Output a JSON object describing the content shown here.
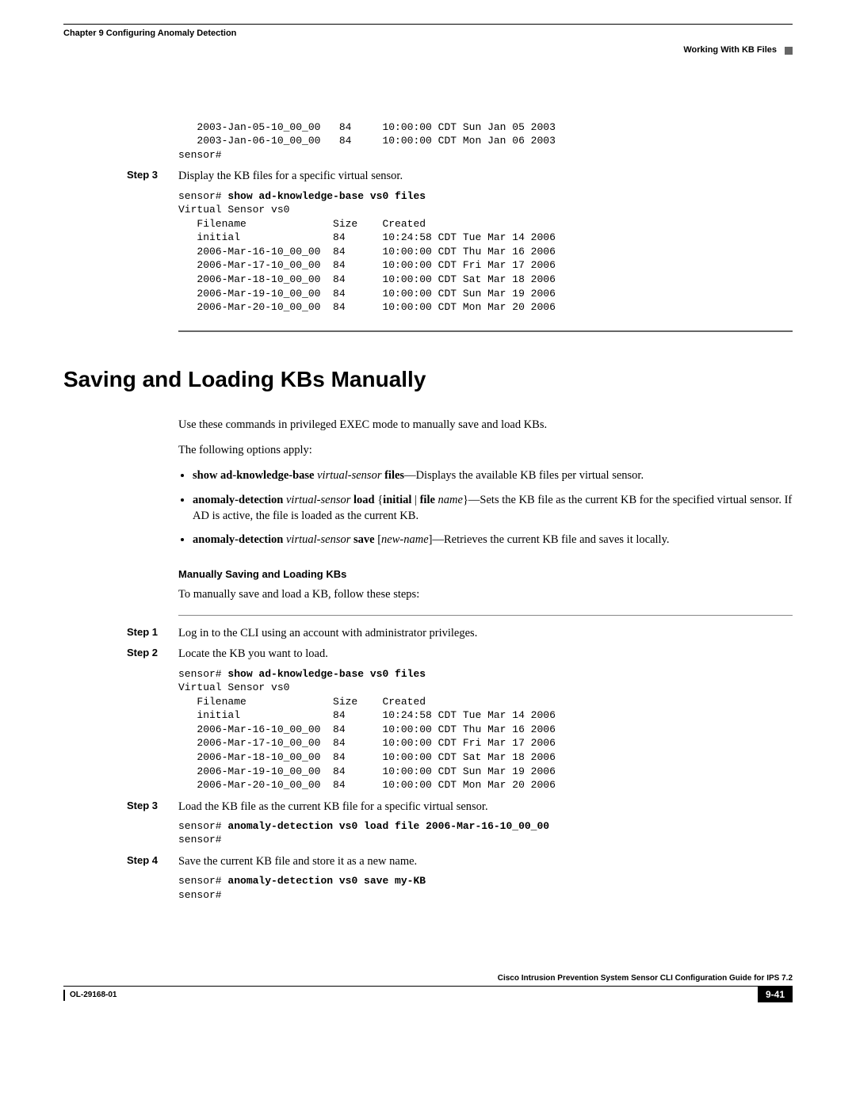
{
  "header": {
    "chapter": "Chapter 9      Configuring Anomaly Detection",
    "section": "Working With KB Files"
  },
  "codeblock1": "   2003-Jan-05-10_00_00   84     10:00:00 CDT Sun Jan 05 2003\n   2003-Jan-06-10_00_00   84     10:00:00 CDT Mon Jan 06 2003\nsensor#",
  "step3_top": {
    "label": "Step 3",
    "text": "Display the KB files for a specific virtual sensor."
  },
  "codeblock2_prompt": "sensor# ",
  "codeblock2_cmd": "show ad-knowledge-base vs0 files",
  "codeblock2_body": "Virtual Sensor vs0\n   Filename              Size    Created\n   initial               84      10:24:58 CDT Tue Mar 14 2006\n   2006-Mar-16-10_00_00  84      10:00:00 CDT Thu Mar 16 2006\n   2006-Mar-17-10_00_00  84      10:00:00 CDT Fri Mar 17 2006\n   2006-Mar-18-10_00_00  84      10:00:00 CDT Sat Mar 18 2006\n   2006-Mar-19-10_00_00  84      10:00:00 CDT Sun Mar 19 2006\n   2006-Mar-20-10_00_00  84      10:00:00 CDT Mon Mar 20 2006",
  "h1": "Saving and Loading KBs Manually",
  "intro1": "Use these commands in privileged EXEC mode to manually save and load KBs.",
  "intro2": "The following options apply:",
  "bullets": {
    "b1_bold1": "show ad-knowledge-base",
    "b1_italic1": " virtual-sensor ",
    "b1_bold2": "files",
    "b1_rest": "—Displays the available KB files per virtual sensor.",
    "b2_bold1": "anomaly-detection",
    "b2_italic1": " virtual-sensor ",
    "b2_bold2": "load",
    "b2_mid1": " {",
    "b2_bold3": "initial",
    "b2_mid2": " | ",
    "b2_bold4": "file",
    "b2_italic2": " name",
    "b2_mid3": "}—Sets the KB file as the current KB for the specified virtual sensor. If AD is active, the file is loaded as the current KB.",
    "b3_bold1": "anomaly-detection",
    "b3_italic1": " virtual-sensor ",
    "b3_bold2": "save",
    "b3_mid1": " [",
    "b3_italic2": "new-name",
    "b3_mid2": "]—Retrieves the current KB file and saves it locally."
  },
  "subheading": "Manually Saving and Loading KBs",
  "subintro": "To manually save and load a KB, follow these steps:",
  "steps": {
    "s1_label": "Step 1",
    "s1_text": "Log in to the CLI using an account with administrator privileges.",
    "s2_label": "Step 2",
    "s2_text": "Locate the KB you want to load.",
    "s3_label": "Step 3",
    "s3_text": "Load the KB file as the current KB file for a specific virtual sensor.",
    "s4_label": "Step 4",
    "s4_text": "Save the current KB file and store it as a new name."
  },
  "codeblock3_prompt": "sensor# ",
  "codeblock3_cmd": "show ad-knowledge-base vs0 files",
  "codeblock3_body": "Virtual Sensor vs0\n   Filename              Size    Created\n   initial               84      10:24:58 CDT Tue Mar 14 2006\n   2006-Mar-16-10_00_00  84      10:00:00 CDT Thu Mar 16 2006\n   2006-Mar-17-10_00_00  84      10:00:00 CDT Fri Mar 17 2006\n   2006-Mar-18-10_00_00  84      10:00:00 CDT Sat Mar 18 2006\n   2006-Mar-19-10_00_00  84      10:00:00 CDT Sun Mar 19 2006\n   2006-Mar-20-10_00_00  84      10:00:00 CDT Mon Mar 20 2006",
  "codeblock4_prompt": "sensor# ",
  "codeblock4_cmd": "anomaly-detection vs0 load file 2006-Mar-16-10_00_00",
  "codeblock4_body": "sensor#",
  "codeblock5_prompt": "sensor# ",
  "codeblock5_cmd": "anomaly-detection vs0 save my-KB",
  "codeblock5_body": "sensor#",
  "footer": {
    "title": "Cisco Intrusion Prevention System Sensor CLI Configuration Guide for IPS 7.2",
    "docnum": "OL-29168-01",
    "page": "9-41"
  }
}
